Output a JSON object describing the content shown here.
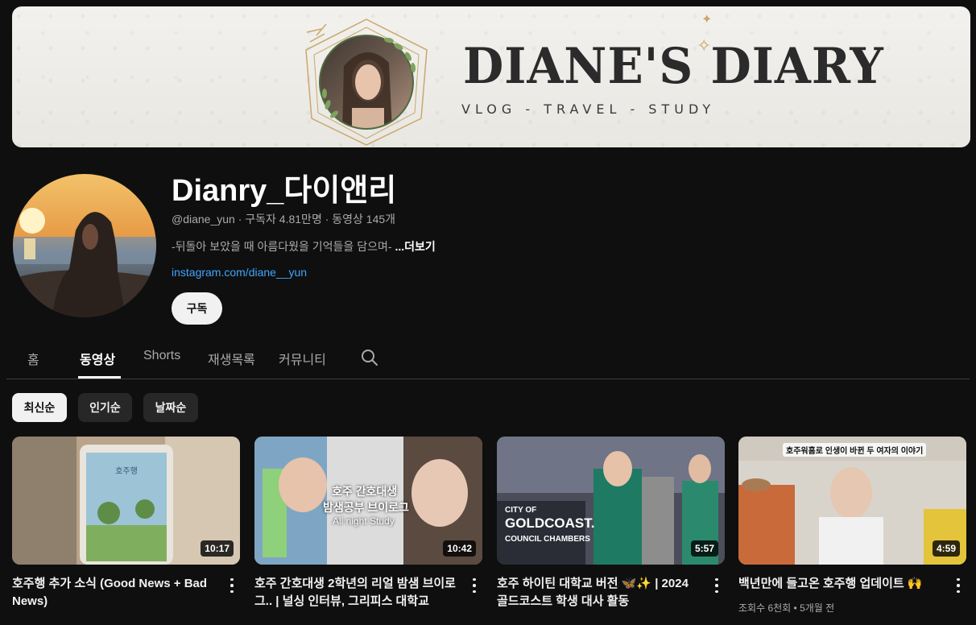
{
  "banner": {
    "title": "DIANE'S DIARY",
    "subtitle": "VLOG - TRAVEL - STUDY"
  },
  "channel": {
    "name": "Dianry_다이앤리",
    "handle": "@diane_yun",
    "subscribers": "구독자 4.81만명",
    "video_count": "동영상 145개",
    "separator": "·",
    "description": "-뒤돌아 보았을 때 아름다웠을 기억들을 담으며-",
    "more_label": "...더보기",
    "link": "instagram.com/diane__yun",
    "subscribe_label": "구독"
  },
  "tabs": [
    {
      "label": "홈"
    },
    {
      "label": "동영상"
    },
    {
      "label": "Shorts"
    },
    {
      "label": "재생목록"
    },
    {
      "label": "커뮤니티"
    }
  ],
  "active_tab": "동영상",
  "chips": [
    {
      "label": "최신순",
      "active": true
    },
    {
      "label": "인기순",
      "active": false
    },
    {
      "label": "날짜순",
      "active": false
    }
  ],
  "videos": [
    {
      "title": "호주행 추가 소식 (Good News + Bad News)",
      "duration": "10:17",
      "meta": ""
    },
    {
      "title": "호주 간호대생 2학년의 리얼 밤샘 브이로그.. | 널싱 인터뷰, 그리피스 대학교",
      "duration": "10:42",
      "meta": "",
      "overlay": {
        "line1": "호주 간호대생",
        "line2": "밤샘공부 브이로그",
        "line3": "All night Study"
      }
    },
    {
      "title": "호주 하이틴 대학교 버전 🦋✨ | 2024 골드코스트 학생 대사 활동",
      "duration": "5:57",
      "meta": "",
      "overlay": {
        "line1": "CITY OF",
        "line2": "GOLDCOAST.",
        "line3": "COUNCIL CHAMBERS"
      }
    },
    {
      "title": "백년만에 들고온 호주행 업데이트 🙌",
      "duration": "4:59",
      "meta": "조회수 6천회 • 5개월 전",
      "overlay": {
        "line1": "호주워홈로 인생이 바뀐 두 여자의 이야기"
      }
    }
  ],
  "colors": {
    "background": "#0f0f0f",
    "link": "#3ea6ff",
    "chip": "#272727",
    "muted_text": "#aaaaaa"
  }
}
